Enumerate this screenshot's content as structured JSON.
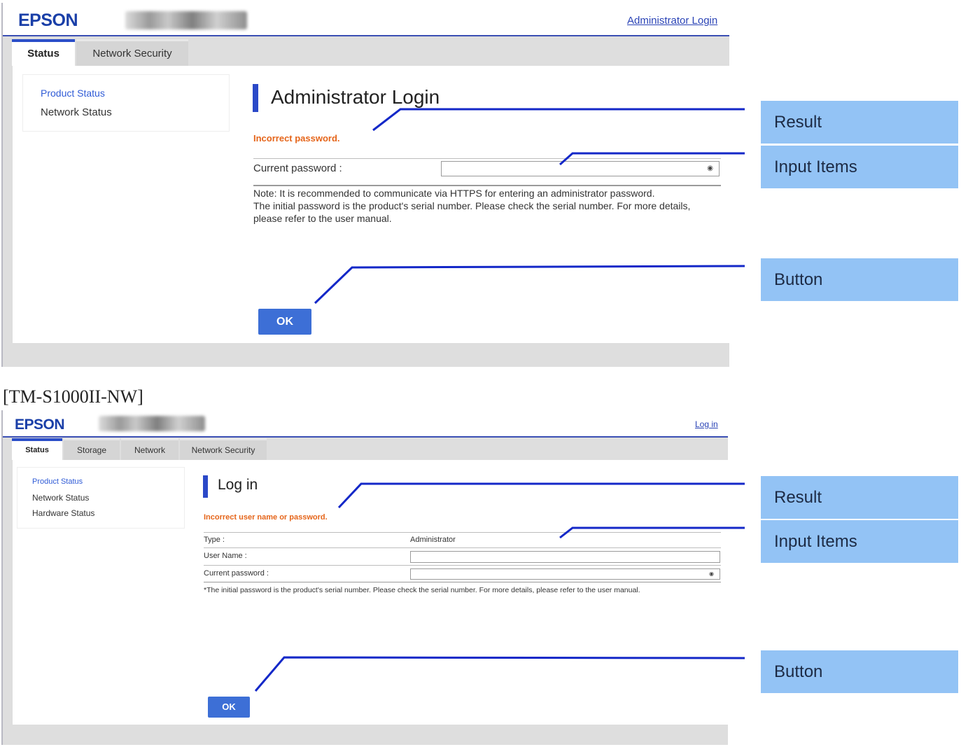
{
  "screen1": {
    "logo": "EPSON",
    "login_link": "Administrator Login",
    "tabs": [
      {
        "label": "Status",
        "active": true
      },
      {
        "label": "Network Security",
        "active": false
      }
    ],
    "sidenav": [
      "Product Status",
      "Network Status"
    ],
    "page_title": "Administrator Login",
    "error": "Incorrect password.",
    "password_label": "Current password :",
    "note_lines": [
      "Note: It is recommended to communicate via HTTPS for entering an administrator password.",
      "The initial password is the product's serial number. Please check the serial number. For more details,",
      "please refer to the user manual."
    ],
    "ok": "OK"
  },
  "caption": "[TM-S1000II-NW]",
  "screen2": {
    "logo": "EPSON",
    "login_link": "Log in",
    "tabs": [
      {
        "label": "Status",
        "active": true
      },
      {
        "label": "Storage",
        "active": false
      },
      {
        "label": "Network",
        "active": false
      },
      {
        "label": "Network Security",
        "active": false
      }
    ],
    "sidenav": [
      "Product Status",
      "Network Status",
      "Hardware Status"
    ],
    "page_title": "Log in",
    "error": "Incorrect user name or password.",
    "type_label": "Type :",
    "type_value": "Administrator",
    "username_label": "User Name :",
    "password_label": "Current password :",
    "note": "*The initial password is the product's serial number. Please check the serial number. For more details, please refer to the user manual.",
    "ok": "OK"
  },
  "callouts": {
    "top": [
      "Result",
      "Input Items",
      "Button"
    ],
    "bottom": [
      "Result",
      "Input Items",
      "Button"
    ]
  },
  "colors": {
    "brand_blue": "#1a3fa8",
    "error_orange": "#e5651a",
    "ok_button": "#3d6fd6",
    "callout_fill": "#93c3f5",
    "leader_line": "#1428c8"
  },
  "icons": {
    "password_visibility": "eye-icon"
  }
}
